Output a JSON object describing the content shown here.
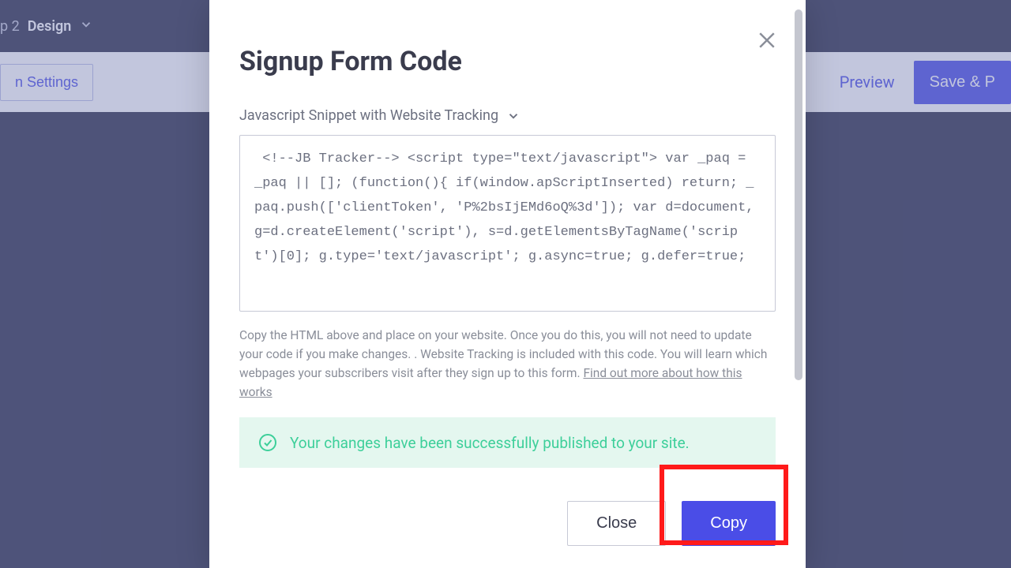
{
  "topbar": {
    "step_prefix": "p 2",
    "step_name": "Design"
  },
  "secondbar": {
    "settings_label": "n Settings",
    "preview_label": "Preview",
    "save_label": "Save & P"
  },
  "modal": {
    "title": "Signup Form Code",
    "dropdown_label": "Javascript Snippet with Website Tracking",
    "code_snippet": " <!--JB Tracker--> <script type=\"text/javascript\"> var _paq = _paq || []; (function(){ if(window.apScriptInserted) return; _paq.push(['clientToken', 'P%2bsIjEMd6oQ%3d']); var d=document, g=d.createElement('script'), s=d.getElementsByTagName('script')[0]; g.type='text/javascript'; g.async=true; g.defer=true;",
    "help_text_1": "Copy the HTML above and place on your website. Once you do this, you will not need to update your code if you make changes. . Website Tracking is included with this code. You will learn which webpages your subscribers visit after they sign up to this form. ",
    "help_link_text": "Find out more about how this works",
    "success_message": "Your changes have been successfully published to your site.",
    "close_label": "Close",
    "copy_label": "Copy"
  }
}
